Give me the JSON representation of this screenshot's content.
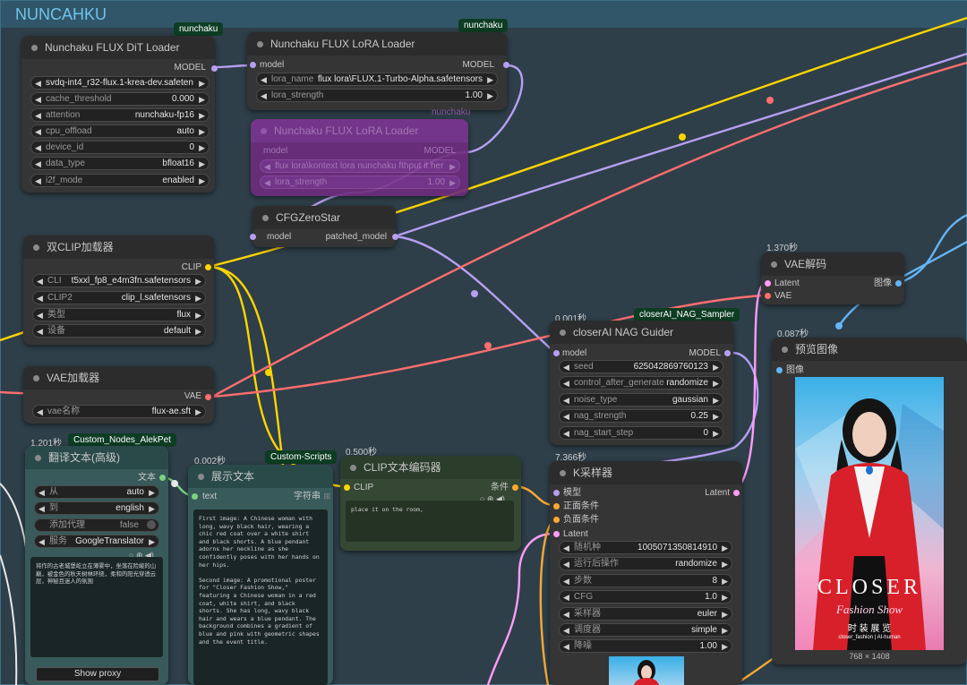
{
  "group": {
    "title": "NUNCAHKU"
  },
  "colors": {
    "model": "#b69ff0",
    "clip": "#ffd500",
    "vae": "#ff6e6e",
    "latent": "#ff9cf9",
    "image": "#64b5f6",
    "string": "#7dd37d",
    "cond": "#ffa931",
    "badge": "#0d3d23"
  },
  "dit": {
    "badge": "nunchaku",
    "title": "Nunchaku FLUX DiT Loader",
    "out": "MODEL",
    "widgets": [
      {
        "label": "svdq-int4_r32-flux.1-krea-dev.safeten",
        "value": ""
      },
      {
        "label": "cache_threshold",
        "value": "0.000"
      },
      {
        "label": "attention",
        "value": "nunchaku-fp16"
      },
      {
        "label": "cpu_offload",
        "value": "auto"
      },
      {
        "label": "device_id",
        "value": "0"
      },
      {
        "label": "data_type",
        "value": "bfloat16"
      },
      {
        "label": "i2f_mode",
        "value": "enabled"
      }
    ]
  },
  "lora": {
    "badge": "nunchaku",
    "title": "Nunchaku FLUX LoRA Loader",
    "in": "model",
    "out": "MODEL",
    "widgets": [
      {
        "label": "lora_name",
        "value": "flux lora\\FLUX.1-Turbo-Alpha.safetensors"
      },
      {
        "label": "lora_strength",
        "value": "1.00"
      }
    ]
  },
  "lora2": {
    "badge": "nunchaku",
    "title": "Nunchaku FLUX LoRA Loader",
    "in": "model",
    "out": "MODEL",
    "widgets": [
      {
        "label": "flux lora\\kontext lora nunchaku fthput it her",
        "value": ""
      },
      {
        "label": "lora_strength",
        "value": "1.00"
      }
    ]
  },
  "cfg": {
    "title": "CFGZeroStar",
    "in": "model",
    "out": "patched_model"
  },
  "dualclip": {
    "title": "双CLIP加载器",
    "out": "CLIP",
    "widgets": [
      {
        "label": "CLI",
        "value": "t5xxl_fp8_e4m3fn.safetensors"
      },
      {
        "label": "CLIP2",
        "value": "clip_l.safetensors"
      },
      {
        "label": "类型",
        "value": "flux"
      },
      {
        "label": "设备",
        "value": "default"
      }
    ]
  },
  "vaeload": {
    "title": "VAE加载器",
    "out": "VAE",
    "widgets": [
      {
        "label": "vae名称",
        "value": "flux-ae.sft"
      }
    ]
  },
  "vaedecode": {
    "time": "1.370秒",
    "title": "VAE解码",
    "in1": "Latent",
    "in2": "VAE",
    "out": "图像"
  },
  "nag": {
    "time": "0.001秒",
    "badge": "closerAI_NAG_Sampler",
    "title": "closerAI NAG Guider",
    "in": "model",
    "out": "MODEL",
    "widgets": [
      {
        "label": "seed",
        "value": "625042869760123"
      },
      {
        "label": "control_after_generate",
        "value": "randomize"
      },
      {
        "label": "noise_type",
        "value": "gaussian"
      },
      {
        "label": "nag_strength",
        "value": "0.25"
      },
      {
        "label": "nag_start_step",
        "value": "0"
      }
    ]
  },
  "preview": {
    "time": "0.087秒",
    "title": "预览图像",
    "in": "图像",
    "size": "768 × 1408",
    "poster": {
      "brand": "CLOSER",
      "script": "Fashion Show",
      "sub": "时 装 展 览",
      "tag": "closer_fashion | AI-human"
    }
  },
  "translate": {
    "time": "1.201秒",
    "badge": "Custom_Nodes_AlekPet",
    "title": "翻译文本(高级)",
    "out": "文本",
    "widgets": [
      {
        "label": "从",
        "value": "auto"
      },
      {
        "label": "到",
        "value": "english"
      },
      {
        "label": "添加代理",
        "value": "false"
      },
      {
        "label": "服务",
        "value": "GoogleTranslator"
      }
    ],
    "text": "将作的古老城堡屹立在薄雾中，坐落在险峻的山巅，被金色的秋天树林环绕，柔和的阳光穿透云层，神秘且迷人的氛围",
    "button": "Show proxy"
  },
  "show": {
    "time": "0.002秒",
    "badge": "Custom-Scripts",
    "title": "展示文本",
    "in": "text",
    "out": "字符串",
    "text": "First image: A Chinese woman with long, wavy black hair, wearing a chic red coat over a white shirt and black shorts. A blue pendant adorns her neckline as she confidently poses with her hands on her hips.\n\nSecond image: A promotional poster for \"Closer Fashion Show,\" featuring a Chinese woman in a red coat, white shirt, and black shorts. She has long, wavy black hair and wears a blue pendant. The background combines a gradient of blue and pink with geometric shapes and the event title."
  },
  "encode": {
    "time": "0.500秒",
    "title": "CLIP文本编码器",
    "in": "CLIP",
    "out": "条件",
    "text": "place it on the room,"
  },
  "ksampler": {
    "time": "7.366秒",
    "title": "K采样器",
    "in1": "模型",
    "in2": "正面条件",
    "in3": "负面条件",
    "in4": "Latent",
    "out": "Latent",
    "widgets": [
      {
        "label": "随机种",
        "value": "1005071350814910"
      },
      {
        "label": "运行后操作",
        "value": "randomize"
      },
      {
        "label": "步数",
        "value": "8"
      },
      {
        "label": "CFG",
        "value": "1.0"
      },
      {
        "label": "采样器",
        "value": "euler"
      },
      {
        "label": "调度器",
        "value": "simple"
      },
      {
        "label": "降噪",
        "value": "1.00"
      }
    ]
  }
}
